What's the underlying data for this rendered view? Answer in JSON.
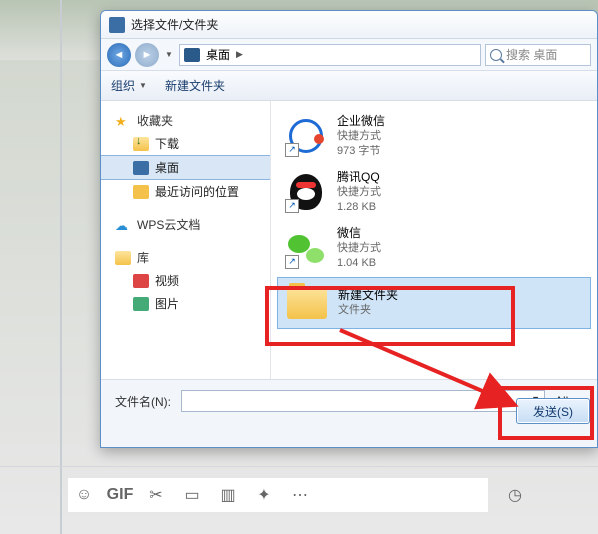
{
  "dialog": {
    "title": "选择文件/文件夹",
    "breadcrumb": {
      "location": "桌面"
    },
    "search": {
      "placeholder": "搜索 桌面"
    },
    "toolbar": {
      "organize": "组织",
      "new_folder": "新建文件夹"
    },
    "sidebar": {
      "favorites": {
        "label": "收藏夹",
        "items": [
          "下载",
          "桌面",
          "最近访问的位置"
        ]
      },
      "cloud": {
        "label": "WPS云文档"
      },
      "libraries": {
        "label": "库",
        "items": [
          "视频",
          "图片"
        ]
      }
    },
    "files": [
      {
        "name": "企业微信",
        "sub1": "快捷方式",
        "sub2": "973 字节"
      },
      {
        "name": "腾讯QQ",
        "sub1": "快捷方式",
        "sub2": "1.28 KB"
      },
      {
        "name": "微信",
        "sub1": "快捷方式",
        "sub2": "1.04 KB"
      },
      {
        "name": "新建文件夹",
        "sub1": "文件夹",
        "sub2": ""
      }
    ],
    "filename_label": "文件名(N):",
    "filter_label": "All",
    "send_button": "发送(S)"
  }
}
